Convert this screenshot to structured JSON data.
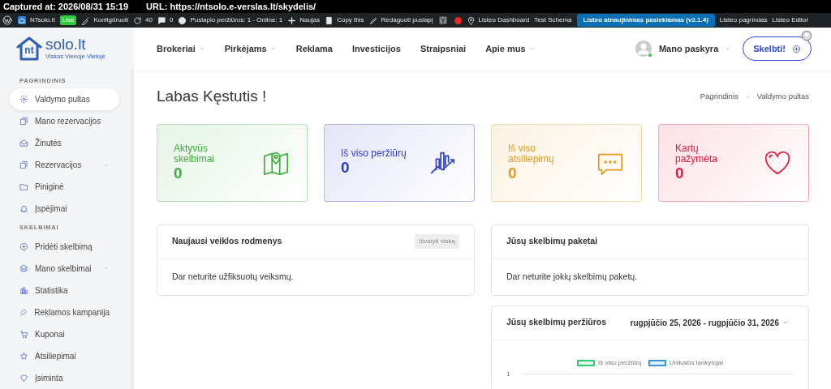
{
  "capture_bar": {
    "captured": "Captured at: 2026/08/31 15:19",
    "url": "URL: https://ntsolo.e-verslas.lt/skydelis/"
  },
  "admin_bar": {
    "site": "NTsolo.lt",
    "live_badge": "Live",
    "items": [
      {
        "kind": "customize",
        "label": "Konfigūruoti"
      },
      {
        "kind": "updates",
        "label": "40"
      },
      {
        "kind": "comments",
        "label": "0"
      },
      {
        "kind": "stats",
        "label": "Puslapio peržiūros: 1 - Online: 1"
      },
      {
        "kind": "new",
        "label": "Naujas"
      },
      {
        "kind": "copy",
        "label": "Copy this"
      },
      {
        "kind": "edit",
        "label": "Redaguoti puslapį"
      },
      {
        "kind": "seo"
      },
      {
        "kind": "pin",
        "label": "Listeo Dashboard"
      },
      {
        "kind": "plain",
        "label": "Test Schema"
      },
      {
        "kind": "notice",
        "label": "Listeo atnaujinimas pasiekiamas (v2.1.4)"
      },
      {
        "kind": "plain",
        "label": "Listeo pagrindas"
      },
      {
        "kind": "plain",
        "label": "Listeo Editor"
      }
    ]
  },
  "header": {
    "logo": {
      "mark": "nt",
      "name": "solo.lt",
      "tagline": "Viskas Vienoje Vietoje"
    },
    "nav": [
      {
        "label": "Brokeriai",
        "dropdown": true
      },
      {
        "label": "Pirkėjams",
        "dropdown": true
      },
      {
        "label": "Reklama",
        "dropdown": false
      },
      {
        "label": "Investicijos",
        "dropdown": false
      },
      {
        "label": "Straipsniai",
        "dropdown": false
      },
      {
        "label": "Apie mus",
        "dropdown": true
      }
    ],
    "account": {
      "label": "Mano paskyra",
      "online": true
    },
    "post_button": "Skelbti!"
  },
  "sidebar": {
    "sections": [
      {
        "title": "PAGRINDINIS",
        "items": [
          {
            "label": "Valdymo pultas",
            "selected": true,
            "submenu": false
          },
          {
            "label": "Mano rezervacijos",
            "selected": false,
            "submenu": false
          },
          {
            "label": "Žinutės",
            "selected": false,
            "submenu": false
          },
          {
            "label": "Rezervacijos",
            "selected": false,
            "submenu": true
          },
          {
            "label": "Piniginė",
            "selected": false,
            "submenu": false
          },
          {
            "label": "Įspėjimai",
            "selected": false,
            "submenu": false
          }
        ]
      },
      {
        "title": "SKELBIMAI",
        "items": [
          {
            "label": "Pridėti skelbimą",
            "selected": false,
            "submenu": false
          },
          {
            "label": "Mano skelbimai",
            "selected": false,
            "submenu": true
          },
          {
            "label": "Statistika",
            "selected": false,
            "submenu": false
          },
          {
            "label": "Reklamos kampanija",
            "selected": false,
            "submenu": false
          },
          {
            "label": "Kuponai",
            "selected": false,
            "submenu": false
          },
          {
            "label": "Atsiliepimai",
            "selected": false,
            "submenu": false
          },
          {
            "label": "Įsiminta",
            "selected": false,
            "submenu": false
          }
        ]
      }
    ]
  },
  "main": {
    "greeting": "Labas Kęstutis !",
    "breadcrumbs": [
      "Pagrindinis",
      "Valdymo pultas"
    ],
    "stats": [
      {
        "label": "Aktyvūs skelbimai",
        "value": "0",
        "color": "#3cae3c"
      },
      {
        "label": "Iš viso peržiūrų",
        "value": "0",
        "color": "#2f3fc4"
      },
      {
        "label": "Iš viso atsiliepimų",
        "value": "0",
        "color": "#e39a1e"
      },
      {
        "label": "Kartų pažymėta",
        "value": "0",
        "color": "#e8173a"
      }
    ],
    "activity": {
      "title": "Naujausi veiklos rodmenys",
      "clear_button": "Išvalyti viską",
      "message": "Dar neturite užfiksuotų veiksmų."
    },
    "packages": {
      "title": "Jūsų skelbimų paketai",
      "message": "Dar neturite jokių skelbimų paketų."
    },
    "views": {
      "title": "Jūsų skelbimų peržiūros",
      "date_range": "rugpjūčio 25, 2026 - rugpjūčio 31, 2026",
      "legend": [
        {
          "label": "Iš viso peržiūrų",
          "color": "#2ecc71"
        },
        {
          "label": "Unikalūs lankytojai",
          "color": "#3498db"
        }
      ],
      "y_tick": "1"
    }
  }
}
